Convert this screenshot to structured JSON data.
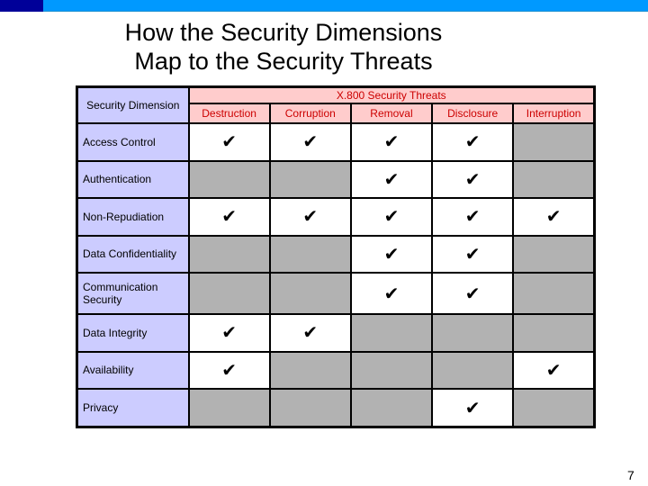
{
  "slide": {
    "title_line1": "How the Security Dimensions",
    "title_line2": "Map to the Security Threats",
    "page_number": "7",
    "colors": {
      "topbar": "#0099ff",
      "topbar_accent": "#000099",
      "header_bg": "#ffcccc",
      "header_text": "#cc0000",
      "dimension_bg": "#ccccff",
      "no_cell": "#b2b2b2"
    }
  },
  "table": {
    "dimension_header": "Security Dimension",
    "threats_header": "X.800 Security Threats",
    "check_glyph": "✔",
    "columns": [
      "Destruction",
      "Corruption",
      "Removal",
      "Disclosure",
      "Interruption"
    ],
    "rows": [
      {
        "dimension": "Access Control",
        "marks": [
          true,
          true,
          true,
          true,
          false
        ]
      },
      {
        "dimension": "Authentication",
        "marks": [
          false,
          false,
          true,
          true,
          false
        ]
      },
      {
        "dimension": "Non-Repudiation",
        "marks": [
          true,
          true,
          true,
          true,
          true
        ]
      },
      {
        "dimension": "Data Confidentiality",
        "marks": [
          false,
          false,
          true,
          true,
          false
        ]
      },
      {
        "dimension": "Communication Security",
        "marks": [
          false,
          false,
          true,
          true,
          false
        ]
      },
      {
        "dimension": "Data Integrity",
        "marks": [
          true,
          true,
          false,
          false,
          false
        ]
      },
      {
        "dimension": "Availability",
        "marks": [
          true,
          false,
          false,
          false,
          true
        ]
      },
      {
        "dimension": "Privacy",
        "marks": [
          false,
          false,
          false,
          true,
          false
        ]
      }
    ]
  }
}
